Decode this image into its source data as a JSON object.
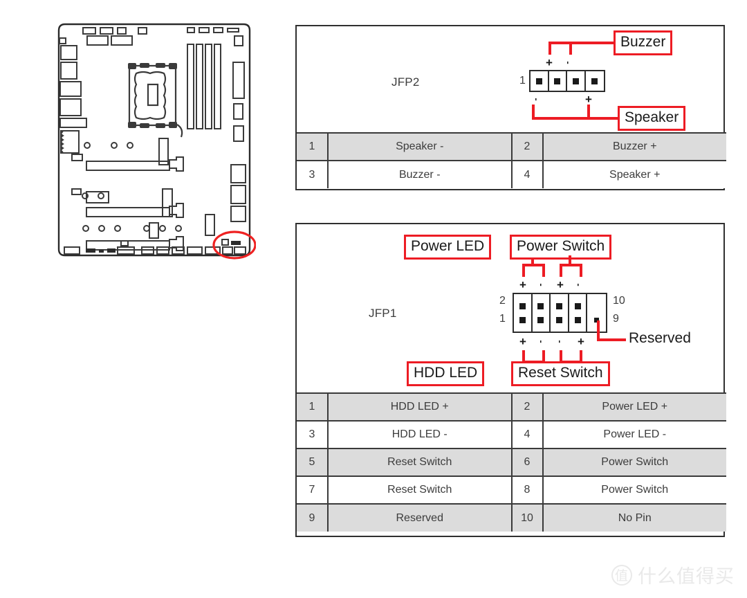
{
  "board": {
    "label": "motherboard-diagram",
    "highlight_color": "#ee2222",
    "outline_color": "#2b2b2b"
  },
  "accent": {
    "red": "#ed1c24",
    "ink": "#1a1a1a",
    "gray_text": "#3c3c3c",
    "row_gray": "#dcdcdc",
    "border": "#3a3a3a"
  },
  "jfp2": {
    "connector_name": "JFP2",
    "pin_one_label": "1",
    "callouts": {
      "buzzer": "Buzzer",
      "speaker": "Speaker"
    },
    "polarity": {
      "top_plus": "+",
      "top_minus": "-",
      "bottom_minus": "-",
      "bottom_plus": "+"
    },
    "table": [
      {
        "left_num": "1",
        "left_desc": "Speaker -",
        "right_num": "2",
        "right_desc": "Buzzer +"
      },
      {
        "left_num": "3",
        "left_desc": "Buzzer -",
        "right_num": "4",
        "right_desc": "Speaker +"
      }
    ]
  },
  "jfp1": {
    "connector_name": "JFP1",
    "pin_labels": {
      "top_left": "2",
      "bottom_left": "1",
      "top_right": "10",
      "bottom_right": "9"
    },
    "callouts": {
      "power_led": "Power LED",
      "power_switch": "Power Switch",
      "hdd_led": "HDD LED",
      "reset_switch": "Reset Switch",
      "reserved": "Reserved"
    },
    "polarity": {
      "top": [
        "+",
        "-",
        "+",
        "-"
      ],
      "bottom": [
        "+",
        "-",
        "-",
        "+"
      ]
    },
    "table": [
      {
        "left_num": "1",
        "left_desc": "HDD LED +",
        "right_num": "2",
        "right_desc": "Power LED +"
      },
      {
        "left_num": "3",
        "left_desc": "HDD LED -",
        "right_num": "4",
        "right_desc": "Power LED -"
      },
      {
        "left_num": "5",
        "left_desc": "Reset Switch",
        "right_num": "6",
        "right_desc": "Power Switch"
      },
      {
        "left_num": "7",
        "left_desc": "Reset Switch",
        "right_num": "8",
        "right_desc": "Power Switch"
      },
      {
        "left_num": "9",
        "left_desc": "Reserved",
        "right_num": "10",
        "right_desc": "No Pin"
      }
    ]
  },
  "watermark": {
    "mark": "值",
    "text": "什么值得买"
  }
}
